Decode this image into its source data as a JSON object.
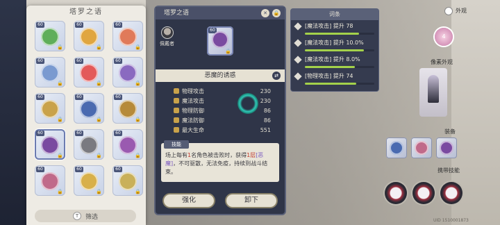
{
  "collection": {
    "title": "塔罗之语",
    "filter_label": "筛选",
    "cards": [
      {
        "level": "60",
        "color": "#5fae5a",
        "locked": true
      },
      {
        "level": "60",
        "color": "#e0a640",
        "locked": true
      },
      {
        "level": "60",
        "color": "#e07a5a",
        "locked": true
      },
      {
        "level": "60",
        "color": "#7a9ad0",
        "locked": true
      },
      {
        "level": "60",
        "color": "#e35a5a",
        "locked": true
      },
      {
        "level": "60",
        "color": "#8a6ac0",
        "locked": true
      },
      {
        "level": "60",
        "color": "#c9a24a",
        "locked": true
      },
      {
        "level": "60",
        "color": "#4a6ab0",
        "locked": true
      },
      {
        "level": "60",
        "color": "#b68a3a",
        "locked": true
      },
      {
        "level": "60",
        "color": "#7a4aa0",
        "locked": true
      },
      {
        "level": "60",
        "color": "#7a7a80",
        "locked": true
      },
      {
        "level": "60",
        "color": "#9a5ab0",
        "locked": true
      },
      {
        "level": "60",
        "color": "#c06a8a",
        "locked": true
      },
      {
        "level": "60",
        "color": "#d8b04a",
        "locked": true
      },
      {
        "level": "60",
        "color": "#c9b05a",
        "locked": true
      }
    ]
  },
  "detail": {
    "header_title": "塔罗之语",
    "owner": "佩戴者",
    "card_level": "60",
    "card_name": "恶魔的诱惑",
    "stats": [
      {
        "label": "物理攻击",
        "value": "230"
      },
      {
        "label": "魔法攻击",
        "value": "230"
      },
      {
        "label": "物理防御",
        "value": "86"
      },
      {
        "label": "魔法防御",
        "value": "86"
      },
      {
        "label": "最大生命",
        "value": "551"
      }
    ],
    "skill_tag": "技能",
    "skill_text_a": "场上每有",
    "skill_num": "1",
    "skill_text_b": "名角色被击败时，获得",
    "skill_stack": "1层",
    "skill_buff": "[恶魔]",
    "skill_text_c": "，不可驱散，无法免疫，持续到战斗结束。",
    "enhance_label": "强化",
    "unequip_label": "卸下"
  },
  "affix": {
    "title": "词条",
    "rows": [
      {
        "text": "[魔法攻击] 提升 78",
        "fill": 0.78
      },
      {
        "text": "[魔法攻击] 提升 10.0%",
        "fill": 0.85
      },
      {
        "text": "[魔法攻击] 提升 8.0%",
        "fill": 0.72
      },
      {
        "text": "[物理攻击] 提升 74",
        "fill": 0.74
      }
    ]
  },
  "right": {
    "appearance": "外观",
    "pink_gem_num": "4",
    "avatar_label": "像素外观",
    "equip_label": "装备",
    "battle_label": "携带技能",
    "uid": "UID 1510001873"
  }
}
